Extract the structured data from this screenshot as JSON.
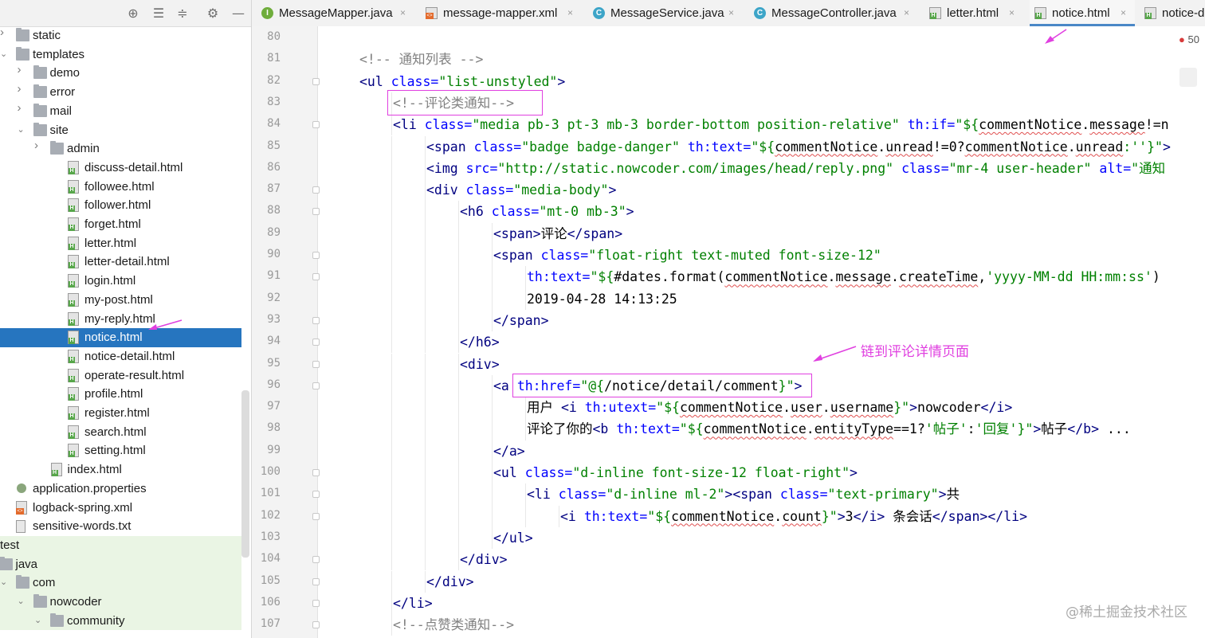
{
  "sidebar": {
    "toolbar_icons": [
      "target-icon",
      "expand-all-icon",
      "collapse-all-icon",
      "gear-icon",
      "minimize-icon"
    ],
    "tree": [
      {
        "label": "static",
        "type": "folder",
        "indent": 0,
        "chevron": "right"
      },
      {
        "label": "templates",
        "type": "folder",
        "indent": 0,
        "chevron": "down"
      },
      {
        "label": "demo",
        "type": "folder",
        "indent": 1,
        "chevron": "right"
      },
      {
        "label": "error",
        "type": "folder",
        "indent": 1,
        "chevron": "right"
      },
      {
        "label": "mail",
        "type": "folder",
        "indent": 1,
        "chevron": "right"
      },
      {
        "label": "site",
        "type": "folder",
        "indent": 1,
        "chevron": "down"
      },
      {
        "label": "admin",
        "type": "folder",
        "indent": 2,
        "chevron": "right"
      },
      {
        "label": "discuss-detail.html",
        "type": "html",
        "indent": 2
      },
      {
        "label": "followee.html",
        "type": "html",
        "indent": 2
      },
      {
        "label": "follower.html",
        "type": "html",
        "indent": 2
      },
      {
        "label": "forget.html",
        "type": "html",
        "indent": 2
      },
      {
        "label": "letter.html",
        "type": "html",
        "indent": 2
      },
      {
        "label": "letter-detail.html",
        "type": "html",
        "indent": 2
      },
      {
        "label": "login.html",
        "type": "html",
        "indent": 2
      },
      {
        "label": "my-post.html",
        "type": "html",
        "indent": 2
      },
      {
        "label": "my-reply.html",
        "type": "html",
        "indent": 2
      },
      {
        "label": "notice.html",
        "type": "html",
        "indent": 2,
        "selected": true
      },
      {
        "label": "notice-detail.html",
        "type": "html",
        "indent": 2
      },
      {
        "label": "operate-result.html",
        "type": "html",
        "indent": 2
      },
      {
        "label": "profile.html",
        "type": "html",
        "indent": 2
      },
      {
        "label": "register.html",
        "type": "html",
        "indent": 2
      },
      {
        "label": "search.html",
        "type": "html",
        "indent": 2
      },
      {
        "label": "setting.html",
        "type": "html",
        "indent": 2
      },
      {
        "label": "index.html",
        "type": "html",
        "indent": 1
      },
      {
        "label": "application.properties",
        "type": "props",
        "indent": 0
      },
      {
        "label": "logback-spring.xml",
        "type": "xml",
        "indent": 0
      },
      {
        "label": "sensitive-words.txt",
        "type": "txt",
        "indent": 0
      },
      {
        "label": "test",
        "type": "plain",
        "indent": -1,
        "test": true
      },
      {
        "label": "java",
        "type": "folder",
        "indent": -1,
        "chevron": "down",
        "test": true
      },
      {
        "label": "com",
        "type": "folder",
        "indent": 0,
        "chevron": "down",
        "test": true
      },
      {
        "label": "nowcoder",
        "type": "folder",
        "indent": 1,
        "chevron": "down",
        "test": true
      },
      {
        "label": "community",
        "type": "folder",
        "indent": 2,
        "chevron": "down",
        "test": true
      }
    ]
  },
  "tabs": [
    {
      "label": "MessageMapper.java",
      "icon": "java",
      "letter": "I"
    },
    {
      "label": "message-mapper.xml",
      "icon": "xml"
    },
    {
      "label": "MessageService.java",
      "icon": "class",
      "letter": "C"
    },
    {
      "label": "MessageController.java",
      "icon": "class",
      "letter": "C"
    },
    {
      "label": "letter.html",
      "icon": "html"
    },
    {
      "label": "notice.html",
      "icon": "html",
      "active": true
    },
    {
      "label": "notice-d",
      "icon": "html"
    }
  ],
  "tab_close_glyph": "×",
  "editor": {
    "error_count": "50",
    "line_numbers": [
      "80",
      "81",
      "82",
      "83",
      "84",
      "85",
      "86",
      "87",
      "88",
      "89",
      "90",
      "91",
      "92",
      "93",
      "94",
      "95",
      "96",
      "97",
      "98",
      "99",
      "100",
      "101",
      "102",
      "103",
      "104",
      "105",
      "106",
      "107"
    ],
    "lines": [
      [],
      [
        {
          "t": "<!-- 通知列表 -->",
          "c": "cmt"
        }
      ],
      [
        {
          "t": "<ul ",
          "c": "tag"
        },
        {
          "t": "class=",
          "c": "attr"
        },
        {
          "t": "\"list-unstyled\"",
          "c": "str"
        },
        {
          "t": ">",
          "c": "tag"
        }
      ],
      [
        {
          "t": "<!--评论类通知-->",
          "c": "cmt"
        }
      ],
      [
        {
          "t": "<li ",
          "c": "tag"
        },
        {
          "t": "class=",
          "c": "attr"
        },
        {
          "t": "\"media pb-3 pt-3 mb-3 border-bottom position-relative\"",
          "c": "str"
        },
        {
          "t": " ",
          "c": "text"
        },
        {
          "t": "th:if=",
          "c": "attr"
        },
        {
          "t": "\"${",
          "c": "str"
        },
        {
          "t": "commentNotice",
          "c": "squig"
        },
        {
          "t": ".",
          "c": "text"
        },
        {
          "t": "message",
          "c": "squig"
        },
        {
          "t": "!=n",
          "c": "text"
        }
      ],
      [
        {
          "t": "<span ",
          "c": "tag"
        },
        {
          "t": "class=",
          "c": "attr"
        },
        {
          "t": "\"badge badge-danger\"",
          "c": "str"
        },
        {
          "t": " ",
          "c": "text"
        },
        {
          "t": "th:text=",
          "c": "attr"
        },
        {
          "t": "\"${",
          "c": "str"
        },
        {
          "t": "commentNotice",
          "c": "squig"
        },
        {
          "t": ".",
          "c": "text"
        },
        {
          "t": "unread",
          "c": "squig"
        },
        {
          "t": "!=0?",
          "c": "text"
        },
        {
          "t": "commentNotice",
          "c": "squig"
        },
        {
          "t": ".",
          "c": "text"
        },
        {
          "t": "unread",
          "c": "squig"
        },
        {
          "t": ":''}\"",
          "c": "str"
        },
        {
          "t": ">",
          "c": "tag"
        }
      ],
      [
        {
          "t": "<img ",
          "c": "tag"
        },
        {
          "t": "src=",
          "c": "attr"
        },
        {
          "t": "\"http://static.nowcoder.com/images/head/reply.png\"",
          "c": "str"
        },
        {
          "t": " ",
          "c": "text"
        },
        {
          "t": "class=",
          "c": "attr"
        },
        {
          "t": "\"mr-4 user-header\"",
          "c": "str"
        },
        {
          "t": " ",
          "c": "text"
        },
        {
          "t": "alt=",
          "c": "attr"
        },
        {
          "t": "\"通知",
          "c": "str"
        }
      ],
      [
        {
          "t": "<div ",
          "c": "tag"
        },
        {
          "t": "class=",
          "c": "attr"
        },
        {
          "t": "\"media-body\"",
          "c": "str"
        },
        {
          "t": ">",
          "c": "tag"
        }
      ],
      [
        {
          "t": "<h6 ",
          "c": "tag"
        },
        {
          "t": "class=",
          "c": "attr"
        },
        {
          "t": "\"mt-0 mb-3\"",
          "c": "str"
        },
        {
          "t": ">",
          "c": "tag"
        }
      ],
      [
        {
          "t": "<span>",
          "c": "tag"
        },
        {
          "t": "评论",
          "c": "text"
        },
        {
          "t": "</span>",
          "c": "tag"
        }
      ],
      [
        {
          "t": "<span ",
          "c": "tag"
        },
        {
          "t": "class=",
          "c": "attr"
        },
        {
          "t": "\"float-right text-muted font-size-12\"",
          "c": "str"
        }
      ],
      [
        {
          "t": "th:text=",
          "c": "attr"
        },
        {
          "t": "\"${",
          "c": "str"
        },
        {
          "t": "#dates.",
          "c": "text"
        },
        {
          "t": "format",
          "c": "text"
        },
        {
          "t": "(",
          "c": "text"
        },
        {
          "t": "commentNotice",
          "c": "squig"
        },
        {
          "t": ".",
          "c": "text"
        },
        {
          "t": "message",
          "c": "squig"
        },
        {
          "t": ".",
          "c": "text"
        },
        {
          "t": "createTime",
          "c": "squig"
        },
        {
          "t": ",",
          "c": "text"
        },
        {
          "t": "'yyyy-MM-dd HH:mm:ss'",
          "c": "str"
        },
        {
          "t": ")",
          "c": "text"
        }
      ],
      [
        {
          "t": "2019-04-28 14:13:25",
          "c": "text"
        }
      ],
      [
        {
          "t": "</span>",
          "c": "tag"
        }
      ],
      [
        {
          "t": "</h6>",
          "c": "tag"
        }
      ],
      [
        {
          "t": "<div>",
          "c": "tag"
        }
      ],
      [
        {
          "t": "<a ",
          "c": "tag"
        },
        {
          "t": "th:href=",
          "c": "attr"
        },
        {
          "t": "\"@{",
          "c": "str"
        },
        {
          "t": "/notice/detail/comment",
          "c": "text"
        },
        {
          "t": "}\"",
          "c": "str"
        },
        {
          "t": ">",
          "c": "tag"
        }
      ],
      [
        {
          "t": "用户 ",
          "c": "text"
        },
        {
          "t": "<i ",
          "c": "tag"
        },
        {
          "t": "th:utext=",
          "c": "attr"
        },
        {
          "t": "\"${",
          "c": "str"
        },
        {
          "t": "commentNotice",
          "c": "squig"
        },
        {
          "t": ".",
          "c": "text"
        },
        {
          "t": "user",
          "c": "squig"
        },
        {
          "t": ".",
          "c": "text"
        },
        {
          "t": "username",
          "c": "squig"
        },
        {
          "t": "}\"",
          "c": "str"
        },
        {
          "t": ">",
          "c": "tag"
        },
        {
          "t": "nowcoder",
          "c": "text"
        },
        {
          "t": "</i>",
          "c": "tag"
        }
      ],
      [
        {
          "t": "评论了你的",
          "c": "text"
        },
        {
          "t": "<b ",
          "c": "tag"
        },
        {
          "t": "th:text=",
          "c": "attr"
        },
        {
          "t": "\"${",
          "c": "str"
        },
        {
          "t": "commentNotice",
          "c": "squig"
        },
        {
          "t": ".",
          "c": "text"
        },
        {
          "t": "entityType",
          "c": "squig"
        },
        {
          "t": "==1?",
          "c": "text"
        },
        {
          "t": "'帖子'",
          "c": "str"
        },
        {
          "t": ":",
          "c": "text"
        },
        {
          "t": "'回复'",
          "c": "str"
        },
        {
          "t": "}\"",
          "c": "str"
        },
        {
          "t": ">",
          "c": "tag"
        },
        {
          "t": "帖子",
          "c": "text"
        },
        {
          "t": "</b>",
          "c": "tag"
        },
        {
          "t": " ...",
          "c": "text"
        }
      ],
      [
        {
          "t": "</a>",
          "c": "tag"
        }
      ],
      [
        {
          "t": "<ul ",
          "c": "tag"
        },
        {
          "t": "class=",
          "c": "attr"
        },
        {
          "t": "\"d-inline font-size-12 float-right\"",
          "c": "str"
        },
        {
          "t": ">",
          "c": "tag"
        }
      ],
      [
        {
          "t": "<li ",
          "c": "tag"
        },
        {
          "t": "class=",
          "c": "attr"
        },
        {
          "t": "\"d-inline ml-2\"",
          "c": "str"
        },
        {
          "t": ">",
          "c": "tag"
        },
        {
          "t": "<span ",
          "c": "tag"
        },
        {
          "t": "class=",
          "c": "attr"
        },
        {
          "t": "\"text-primary\"",
          "c": "str"
        },
        {
          "t": ">",
          "c": "tag"
        },
        {
          "t": "共",
          "c": "text"
        }
      ],
      [
        {
          "t": "<i ",
          "c": "tag"
        },
        {
          "t": "th:text=",
          "c": "attr"
        },
        {
          "t": "\"${",
          "c": "str"
        },
        {
          "t": "commentNotice",
          "c": "squig"
        },
        {
          "t": ".",
          "c": "text"
        },
        {
          "t": "count",
          "c": "squig"
        },
        {
          "t": "}\"",
          "c": "str"
        },
        {
          "t": ">",
          "c": "tag"
        },
        {
          "t": "3",
          "c": "text"
        },
        {
          "t": "</i>",
          "c": "tag"
        },
        {
          "t": " 条会话",
          "c": "text"
        },
        {
          "t": "</span></li>",
          "c": "tag"
        }
      ],
      [
        {
          "t": "</ul>",
          "c": "tag"
        }
      ],
      [
        {
          "t": "</div>",
          "c": "tag"
        }
      ],
      [
        {
          "t": "</div>",
          "c": "tag"
        }
      ],
      [
        {
          "t": "</li>",
          "c": "tag"
        }
      ],
      [
        {
          "t": "<!--点赞类通知-->",
          "c": "cmt"
        }
      ]
    ],
    "indent_levels": [
      0,
      1,
      1,
      2,
      2,
      3,
      3,
      3,
      4,
      5,
      5,
      6,
      6,
      5,
      4,
      4,
      5,
      6,
      6,
      5,
      5,
      6,
      7,
      5,
      4,
      3,
      2,
      2
    ]
  },
  "annotation": {
    "label": "链到评论详情页面",
    "color": "#e040e0"
  },
  "watermark": "@稀土掘金技术社区"
}
